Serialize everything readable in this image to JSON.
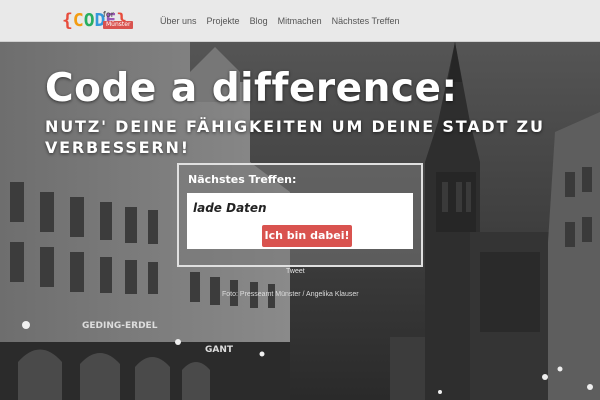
{
  "brand": {
    "logo_braces": "{CODE}",
    "logo_for": "for",
    "logo_city": "Münster",
    "logo_colors": [
      "#e74c3c",
      "#f39c12",
      "#27ae60",
      "#3498db",
      "#9b59b6",
      "#e74c3c"
    ]
  },
  "nav": {
    "items": [
      {
        "label": "Über uns"
      },
      {
        "label": "Projekte"
      },
      {
        "label": "Blog"
      },
      {
        "label": "Mitmachen"
      },
      {
        "label": "Nächstes Treffen"
      }
    ]
  },
  "hero": {
    "headline": "Code a difference:",
    "subline": "NUTZ' DEINE FÄHIGKEITEN UM DEINE STADT ZU VERBESSERN!",
    "sign_left": "GEDING-ERDEL",
    "sign_right": "GANT"
  },
  "meetup": {
    "title": "Nächstes Treffen:",
    "status": "lade Daten",
    "button_label": "Ich bin dabei!",
    "button_color": "#d9534f"
  },
  "social": {
    "tweet_label": "Tweet"
  },
  "photo_credit": "Foto: Presseamt Münster / Angelika Klauser"
}
